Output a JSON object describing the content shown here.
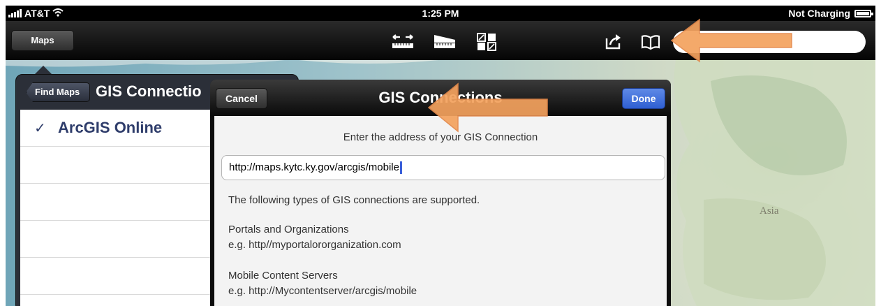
{
  "status": {
    "carrier": "AT&T",
    "time": "1:25 PM",
    "charging": "Not Charging"
  },
  "toolbar": {
    "maps_label": "Maps",
    "icons": [
      "measure-icon",
      "basemap-icon",
      "grid-icon",
      "share-icon",
      "bookmarks-icon"
    ]
  },
  "map": {
    "label": "Asia"
  },
  "popover": {
    "back_label": "Find Maps",
    "title": "GIS Connectio",
    "items": [
      "ArcGIS Online",
      "",
      "",
      "",
      ""
    ]
  },
  "modal": {
    "cancel_label": "Cancel",
    "title": "GIS Connections",
    "done_label": "Done",
    "prompt": "Enter the address of your GIS Connection",
    "url_value": "http://maps.kytc.ky.gov/arcgis/mobile",
    "supported_text": "The following types of GIS connections are supported.",
    "portals_title": "Portals and Organizations",
    "portals_example": "e.g. http//myportalororganization.com",
    "mobile_title": "Mobile Content Servers",
    "mobile_example": "e.g. http://Mycontentserver/arcgis/mobile"
  },
  "colors": {
    "accent_orange": "#f4a25e",
    "done_blue": "#3b67d8",
    "list_text": "#2f3d6b"
  }
}
